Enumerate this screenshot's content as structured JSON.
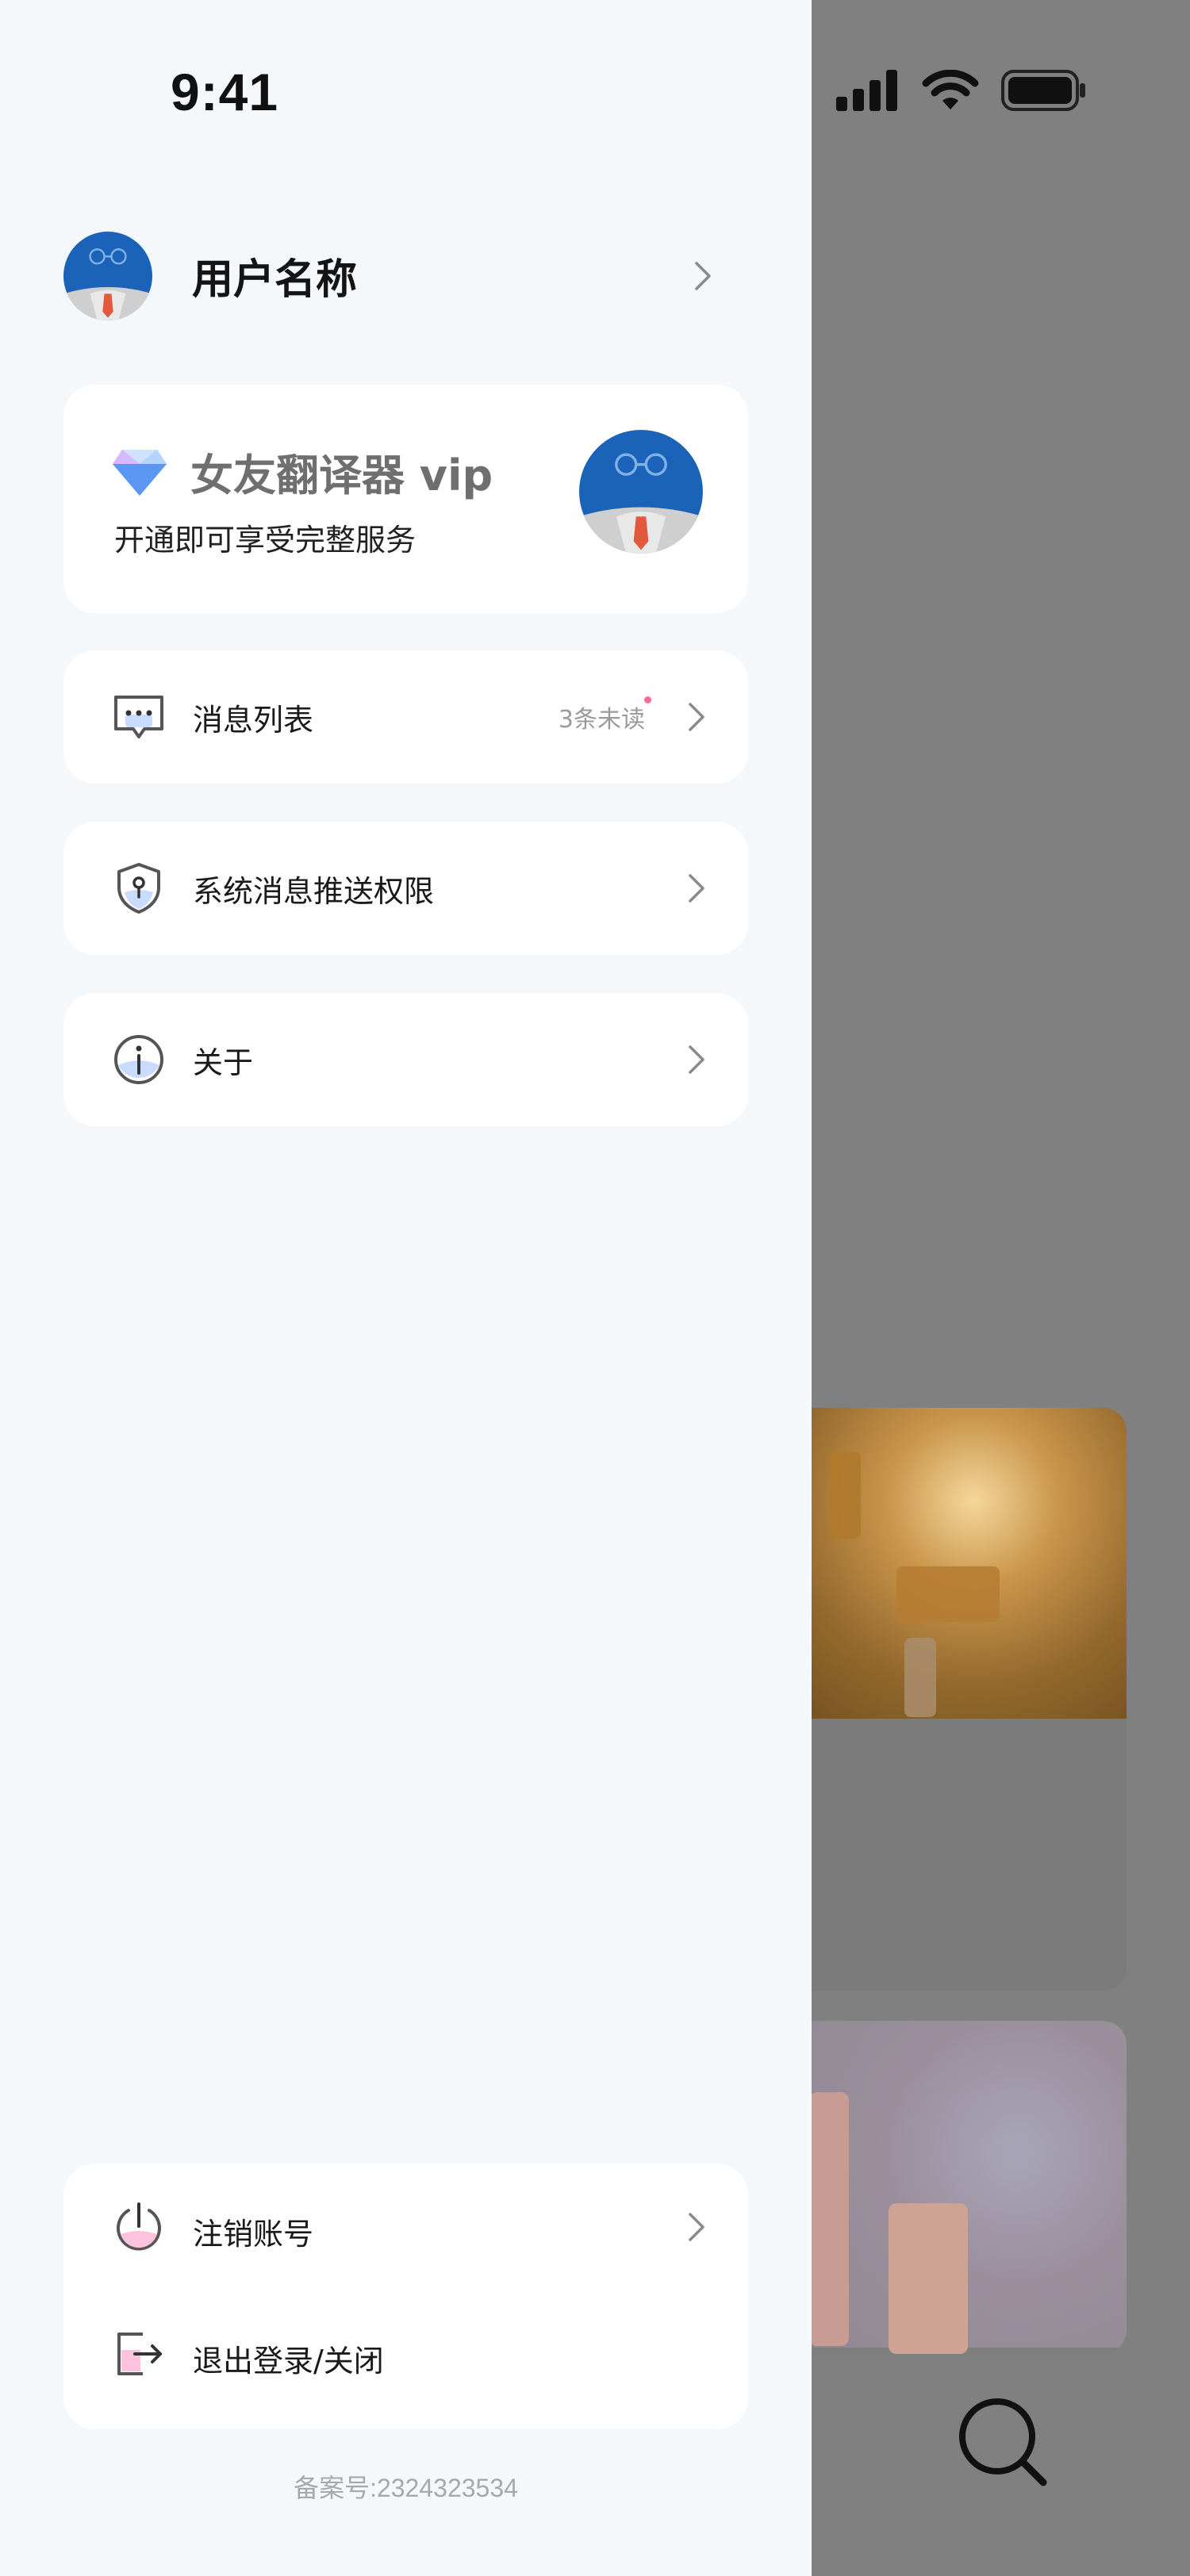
{
  "status": {
    "time": "9:41"
  },
  "user": {
    "name": "用户名称"
  },
  "vip": {
    "title": "女友翻译器 vip",
    "subtitle": "开通即可享受完整服务"
  },
  "menu": [
    {
      "label": "消息列表",
      "badge": "3条未读"
    },
    {
      "label": "系统消息推送权限"
    },
    {
      "label": "关于"
    }
  ],
  "bottom_menu": [
    {
      "label": "注销账号"
    },
    {
      "label": "退出登录/关闭"
    }
  ],
  "footer": {
    "record": "备案号:2324323534"
  },
  "colors": {
    "drawer_bg": "#f5f8fb",
    "card_bg": "#ffffff",
    "accent_pink": "#ff6b9a",
    "avatar_blue": "#1a63b8"
  }
}
